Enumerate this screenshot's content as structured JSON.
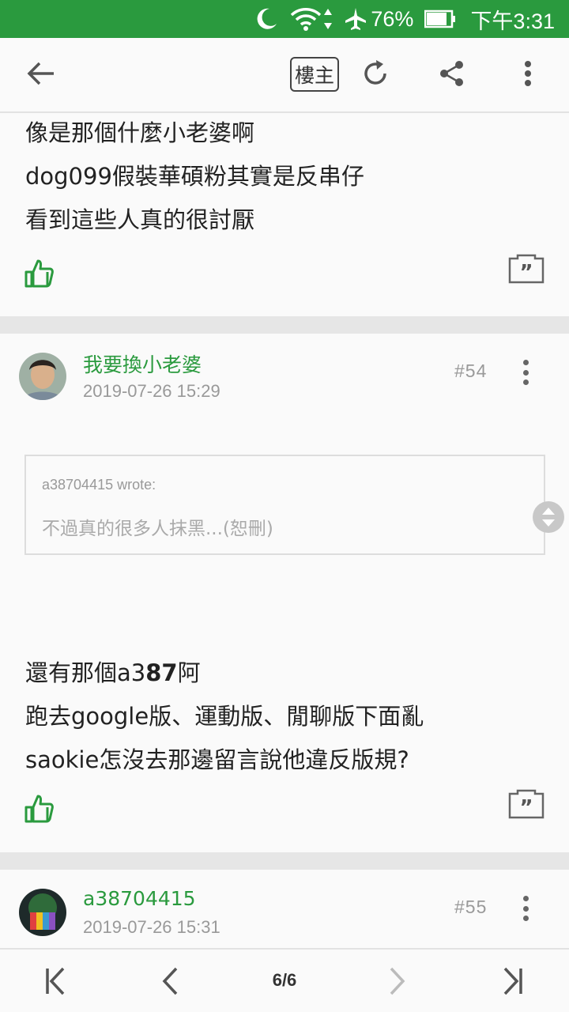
{
  "statusbar": {
    "battery_pct": "76%",
    "time": "下午3:31",
    "icons": [
      "moon-icon",
      "wifi-icon",
      "airplane-icon",
      "battery-icon"
    ]
  },
  "toolbar": {
    "owner_label": "樓主",
    "icons": [
      "back-arrow-icon",
      "refresh-icon",
      "share-icon",
      "more-vert-icon"
    ]
  },
  "post_prev": {
    "lines": [
      "像是那個什麼小老婆啊",
      "dog099假裝華碩粉其實是反串仔",
      "看到這些人真的很討厭"
    ]
  },
  "post54": {
    "author": "我要換小老婆",
    "date": "2019-07-26 15:29",
    "floor": "#54",
    "quote_author": "a38704415 wrote:",
    "quote_text": "不過真的很多人抹黑...(恕刪)",
    "line1_pre": "還有那個a3",
    "line1_bold": "87",
    "line1_post": "阿",
    "line2": "跑去google版、運動版、閒聊版下面亂",
    "line3": "saokie怎沒去那邊留言說他違反版規?"
  },
  "post55": {
    "author": "a38704415",
    "date": "2019-07-26 15:31",
    "floor": "#55"
  },
  "pager": {
    "page": "6/6"
  },
  "colors": {
    "accent": "#2a9a3e",
    "muted": "#999999"
  }
}
